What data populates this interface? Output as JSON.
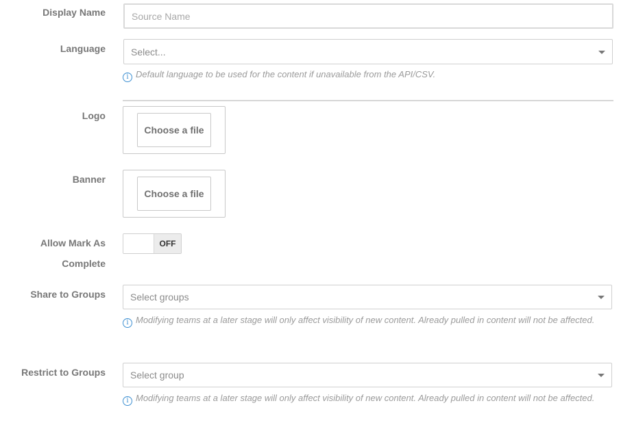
{
  "form": {
    "display_name": {
      "label": "Display Name",
      "placeholder": "Source Name",
      "value": ""
    },
    "language": {
      "label": "Language",
      "selected": "Select...",
      "hint": "Default language to be used for the content if unavailable from the API/CSV."
    },
    "logo": {
      "label": "Logo",
      "button": "Choose a file"
    },
    "banner": {
      "label": "Banner",
      "button": "Choose a file"
    },
    "allow_mark_complete": {
      "label": "Allow Mark As Complete",
      "state": "OFF"
    },
    "share_groups": {
      "label": "Share to Groups",
      "selected": "Select groups",
      "hint": "Modifying teams at a later stage will only affect visibility of new content. Already pulled in content will not be affected."
    },
    "restrict_groups": {
      "label": "Restrict to Groups",
      "selected": "Select group",
      "hint": "Modifying teams at a later stage will only affect visibility of new content. Already pulled in content will not be affected."
    }
  },
  "icons": {
    "info": "info-icon",
    "dropdown": "chevron-down-icon"
  },
  "colors": {
    "info_icon": "#3b8ed1",
    "label": "#777777",
    "border": "#cfcfcf"
  }
}
